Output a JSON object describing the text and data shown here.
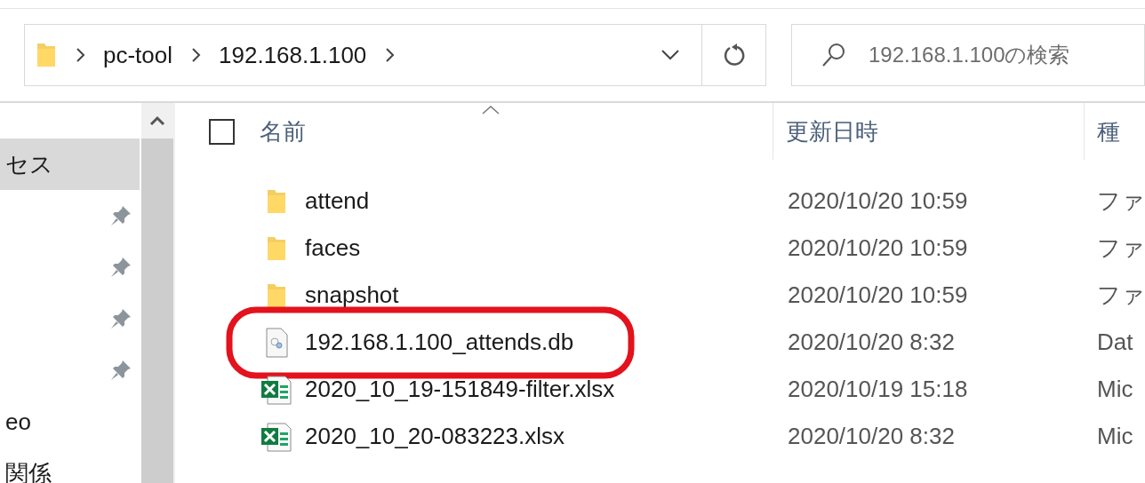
{
  "address_bar": {
    "breadcrumbs": [
      "pc-tool",
      "192.168.1.100"
    ]
  },
  "search": {
    "placeholder": "192.168.1.100の検索"
  },
  "sidebar": {
    "items": [
      {
        "label": "セス",
        "selected": true,
        "pinned": false
      },
      {
        "selected": false,
        "pinned": true
      },
      {
        "selected": false,
        "pinned": true
      },
      {
        "selected": false,
        "pinned": true
      },
      {
        "selected": false,
        "pinned": true
      },
      {
        "label": "eo",
        "selected": false,
        "pinned": false
      },
      {
        "label": "関係",
        "selected": false,
        "pinned": false
      }
    ]
  },
  "table": {
    "select_all": {
      "checked": false
    },
    "columns": [
      "名前",
      "更新日時",
      "種"
    ],
    "rows": [
      {
        "kind": "folder",
        "name": "attend",
        "modified": "2020/10/20 10:59",
        "type": "ファ",
        "circled": false
      },
      {
        "kind": "folder",
        "name": "faces",
        "modified": "2020/10/20 10:59",
        "type": "ファ",
        "circled": false
      },
      {
        "kind": "folder",
        "name": "snapshot",
        "modified": "2020/10/20 10:59",
        "type": "ファ",
        "circled": false
      },
      {
        "kind": "file",
        "name": "192.168.1.100_attends.db",
        "modified": "2020/10/20 8:32",
        "type": "Dat",
        "circled": true
      },
      {
        "kind": "excel",
        "name": "2020_10_19-151849-filter.xlsx",
        "modified": "2020/10/19 15:18",
        "type": "Mic",
        "circled": false
      },
      {
        "kind": "excel",
        "name": "2020_10_20-083223.xlsx",
        "modified": "2020/10/20 8:32",
        "type": "Mic",
        "circled": false
      }
    ]
  }
}
